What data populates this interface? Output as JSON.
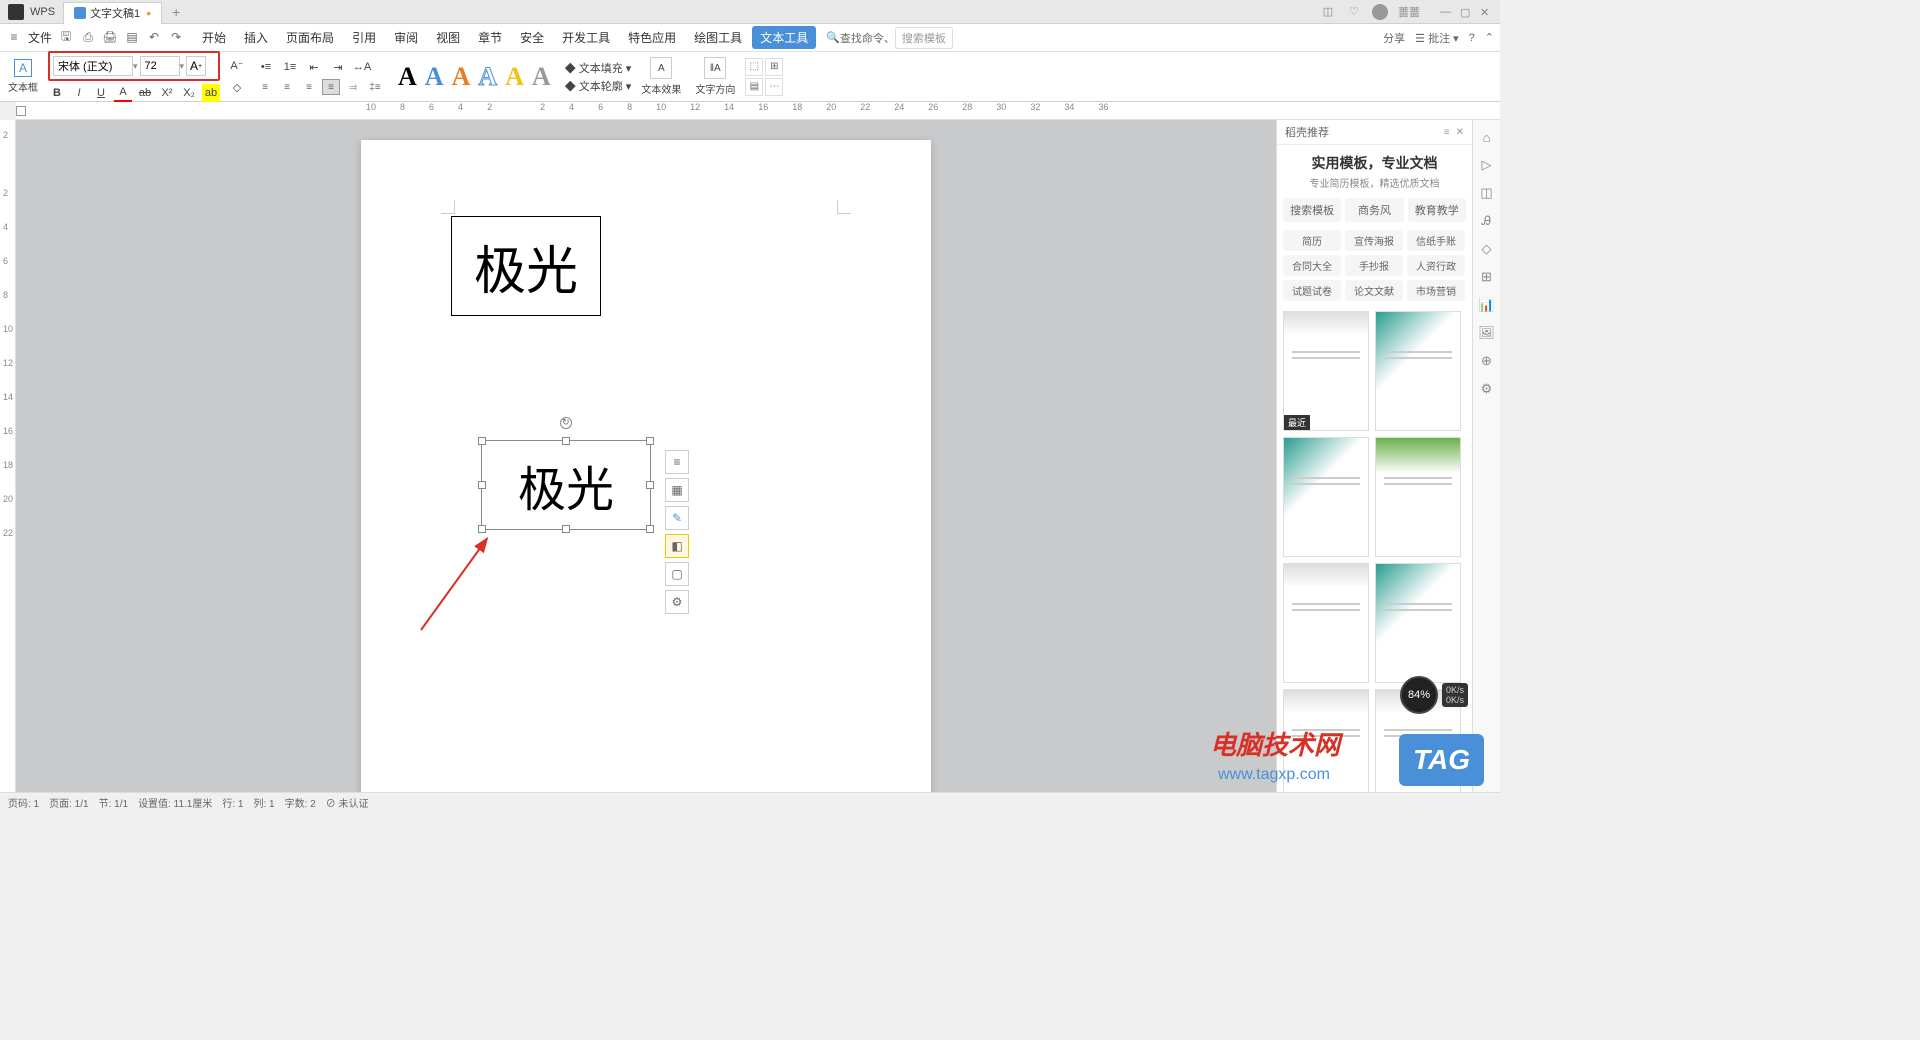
{
  "titlebar": {
    "app_name": "WPS",
    "doc_name": "文字文稿1",
    "user_name": "蔷蔷"
  },
  "menubar": {
    "file": "文件",
    "items": [
      "开始",
      "插入",
      "页面布局",
      "引用",
      "审阅",
      "视图",
      "章节",
      "安全",
      "开发工具",
      "特色应用",
      "绘图工具",
      "文本工具"
    ],
    "active_index": 11,
    "search_cmd": "查找命令、",
    "search_tpl": "搜索模板",
    "share": "分享",
    "annotate": "批注"
  },
  "ribbon": {
    "textbox_label": "文本框",
    "font_name": "宋体 (正文)",
    "font_size": "72",
    "text_fill": "文本填充",
    "text_outline": "文本轮廓",
    "text_effect": "文本效果",
    "text_direction": "文字方向"
  },
  "ruler": {
    "h_numbers": [
      "10",
      "8",
      "6",
      "4",
      "2",
      "",
      "2",
      "4",
      "6",
      "8",
      "10",
      "12",
      "14",
      "16",
      "18",
      "20",
      "22",
      "24",
      "26",
      "28",
      "30",
      "32",
      "34",
      "36"
    ],
    "v_numbers": [
      "2",
      "",
      "2",
      "4",
      "6",
      "8",
      "10",
      "12",
      "14",
      "16",
      "18",
      "20",
      "22"
    ]
  },
  "document": {
    "textbox1_text": "极光",
    "textbox2_text": "极光"
  },
  "right_panel": {
    "header_label": "稻壳推荐",
    "title": "实用模板，专业文档",
    "subtitle": "专业简历模板，精选优质文档",
    "tabs": [
      "搜索模板",
      "商务风",
      "教育教学"
    ],
    "categories": [
      "简历",
      "宣传海报",
      "信纸手账",
      "合同大全",
      "手抄报",
      "人资行政",
      "试题试卷",
      "论文文献",
      "市场营销"
    ],
    "recent_badge": "最近"
  },
  "statusbar": {
    "page_no": "页码: 1",
    "page_of": "页面: 1/1",
    "section": "节: 1/1",
    "pos": "设置值: 11.1厘米",
    "line": "行: 1",
    "col": "列: 1",
    "wordcount": "字数: 2",
    "cert": "未认证"
  },
  "watermark": {
    "site_cn": "电脑技术网",
    "site_url": "www.tagxp.com",
    "tag": "TAG"
  },
  "speed": {
    "pct": "84%",
    "up": "0K/s",
    "down": "0K/s"
  }
}
